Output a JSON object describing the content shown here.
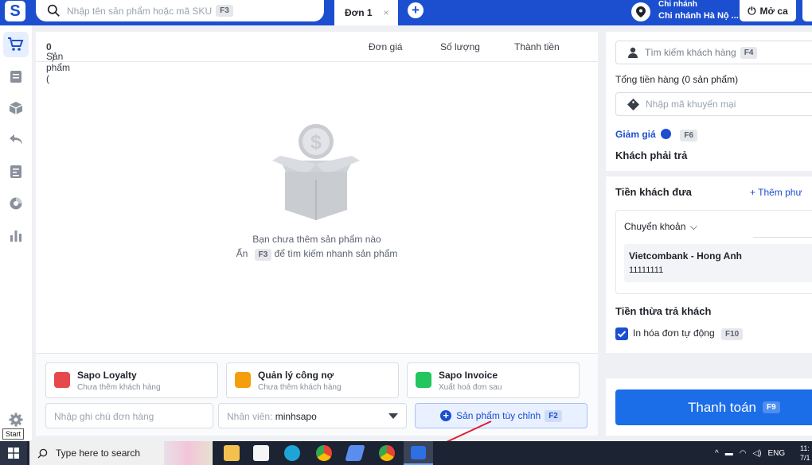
{
  "topbar": {
    "logo": "S",
    "search_placeholder": "Nhập tên sản phẩm hoặc mã SKU",
    "search_key": "F3",
    "tab_label": "Đơn 1",
    "tab_close": "×",
    "add_tab": "+",
    "branch_label": "Chi nhánh",
    "branch_value": "Chi nhánh Hà Nộ ...",
    "shift_button": "Mở ca"
  },
  "sidebar": {
    "items": [
      "cart-icon",
      "order-icon",
      "box-icon",
      "return-icon",
      "report-icon",
      "chart-pie-icon",
      "bar-chart-icon"
    ],
    "settings": "gear-icon",
    "start_tooltip": "Start"
  },
  "products": {
    "col_product_prefix": "Sản phẩm (",
    "count": "0",
    "col_product_suffix": ")",
    "col_price": "Đơn giá",
    "col_qty": "Số lượng",
    "col_total": "Thành tiền",
    "empty_title": "Bạn chưa thêm sản phẩm nào",
    "empty_hint_prefix": "Ấn",
    "empty_hint_key": "F3",
    "empty_hint_suffix": "để tìm kiếm nhanh sản phẩm"
  },
  "extensions": [
    {
      "title": "Sapo Loyalty",
      "subtitle": "Chưa thêm khách hàng",
      "color": "#e5484d"
    },
    {
      "title": "Quản lý công nợ",
      "subtitle": "Chưa thêm khách hàng",
      "color": "#f59e0b"
    },
    {
      "title": "Sapo Invoice",
      "subtitle": "Xuất hoá đơn sau",
      "color": "#22c55e"
    }
  ],
  "footer": {
    "note_placeholder": "Nhập ghi chú đơn hàng",
    "staff_label": "Nhân viên:",
    "staff_value": "minhsapo",
    "custom_product": "Sản phẩm tùy chỉnh",
    "custom_key": "F2"
  },
  "checkout": {
    "customer_search": "Tìm kiếm khách hàng",
    "customer_key": "F4",
    "total_label": "Tổng tiền hàng (0 sản phẩm)",
    "promo_placeholder": "Nhập mã khuyến mại",
    "discount_label": "Giảm giá",
    "discount_key": "F6",
    "must_pay": "Khách phải trả",
    "customer_paid": "Tiền khách đưa",
    "add_method": "+ Thêm phư",
    "method": "Chuyển khoản",
    "bank_name": "Vietcombank - Hong Anh",
    "bank_account": "11111111",
    "change_label": "Tiền thừa trả khách",
    "auto_print": "In hóa đơn tự động",
    "auto_print_key": "F10",
    "pay_button": "Thanh toán",
    "pay_key": "F9"
  },
  "taskbar": {
    "search_placeholder": "Type here to search",
    "lang": "ENG",
    "time": "11:",
    "date": "7/1"
  },
  "colors": {
    "brand": "#1b4fd0",
    "pay": "#1b6de8",
    "annotation": "#e11d2e"
  }
}
